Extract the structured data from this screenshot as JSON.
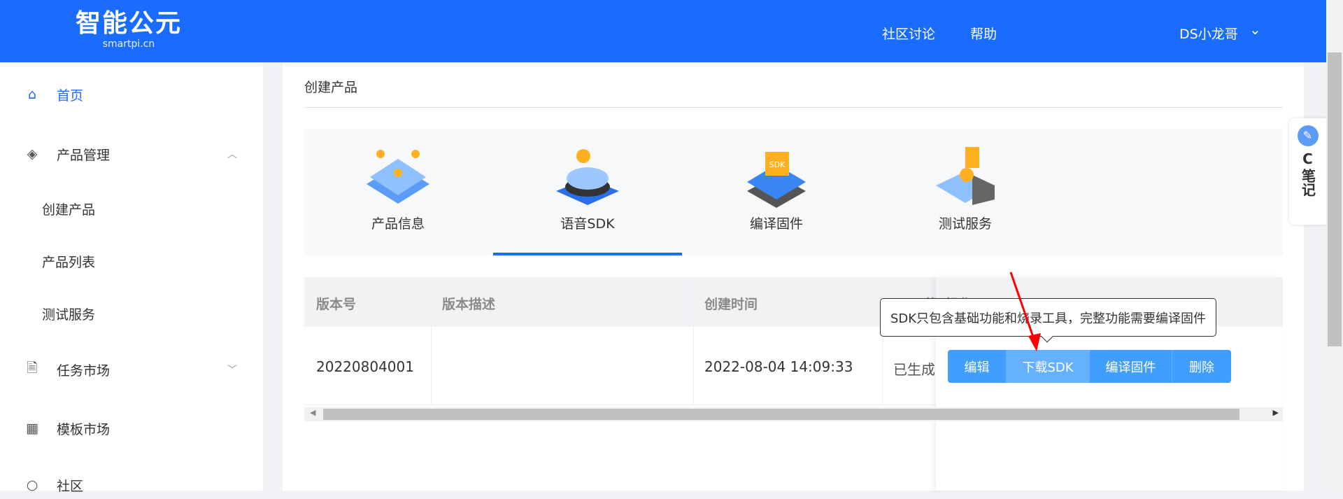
{
  "header": {
    "logo_text": "智能公元",
    "logo_sub": "smartpi.cn",
    "links": [
      "社区讨论",
      "帮助"
    ],
    "user": "DS小龙哥"
  },
  "sidebar": {
    "items": [
      {
        "label": "首页",
        "icon": "home-icon",
        "active": true
      },
      {
        "label": "产品管理",
        "icon": "layers-icon",
        "expanded": true
      },
      {
        "label": "创建产品"
      },
      {
        "label": "产品列表"
      },
      {
        "label": "测试服务"
      },
      {
        "label": "任务市场",
        "icon": "task-icon"
      },
      {
        "label": "模板市场",
        "icon": "grid-icon"
      },
      {
        "label": "社区",
        "icon": "community-icon"
      }
    ]
  },
  "breadcrumb": "创建产品",
  "tabs": [
    {
      "label": "产品信息"
    },
    {
      "label": "语音SDK",
      "active": true
    },
    {
      "label": "编译固件"
    },
    {
      "label": "测试服务"
    }
  ],
  "table": {
    "headers": [
      "版本号",
      "版本描述",
      "创建时间",
      "SDK状",
      "操作"
    ],
    "rows": [
      {
        "version": "20220804001",
        "desc": "",
        "created": "2022-08-04 14:09:33",
        "status": "已生成"
      }
    ],
    "actions": [
      "编辑",
      "下载SDK",
      "编译固件",
      "删除"
    ]
  },
  "tooltip": "SDK只包含基础功能和烧录工具，完整功能需要编译固件",
  "float_widget": {
    "label_c": "C",
    "label": "笔记"
  },
  "colors": {
    "primary": "#1a6cff",
    "button": "#409eff",
    "annotation_arrow": "#ff0000"
  }
}
